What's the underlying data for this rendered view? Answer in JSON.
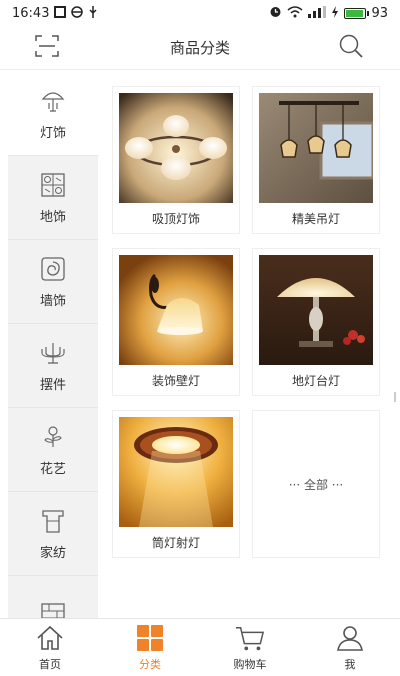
{
  "status_bar": {
    "time": "16:43",
    "battery_level": "93",
    "icons": [
      "notification-icon",
      "vpn-icon",
      "usb-icon",
      "alarm-icon",
      "wifi-icon",
      "signal-icon",
      "charging-icon",
      "battery-icon"
    ]
  },
  "header": {
    "title": "商品分类",
    "left_icon": "scan-icon",
    "right_icon": "search-icon"
  },
  "sidebar": {
    "items": [
      {
        "label": "灯饰",
        "icon": "lamp-icon",
        "active": true
      },
      {
        "label": "地饰",
        "icon": "floor-tile-icon",
        "active": false
      },
      {
        "label": "墙饰",
        "icon": "wall-decor-icon",
        "active": false
      },
      {
        "label": "摆件",
        "icon": "candelabra-icon",
        "active": false
      },
      {
        "label": "花艺",
        "icon": "flower-icon",
        "active": false
      },
      {
        "label": "家纺",
        "icon": "towel-icon",
        "active": false
      },
      {
        "label": "",
        "icon": "brick-icon",
        "active": false
      }
    ]
  },
  "grid": {
    "items": [
      {
        "label": "吸顶灯饰",
        "image": "ceiling-lamp-image"
      },
      {
        "label": "精美吊灯",
        "image": "pendant-lamp-image"
      },
      {
        "label": "装饰壁灯",
        "image": "wall-lamp-image"
      },
      {
        "label": "地灯台灯",
        "image": "table-lamp-image"
      },
      {
        "label": "筒灯射灯",
        "image": "downlight-image"
      }
    ],
    "all_label": "··· 全部 ···"
  },
  "tabbar": {
    "tabs": [
      {
        "label": "首页",
        "icon": "home-icon",
        "active": false
      },
      {
        "label": "分类",
        "icon": "category-grid-icon",
        "active": true
      },
      {
        "label": "购物车",
        "icon": "cart-icon",
        "active": false
      },
      {
        "label": "我",
        "icon": "user-icon",
        "active": false
      }
    ]
  },
  "colors": {
    "accent": "#f0822a",
    "sidebar_bg": "#f2f2f2",
    "text": "#333333",
    "battery_green": "#3cb93c"
  }
}
